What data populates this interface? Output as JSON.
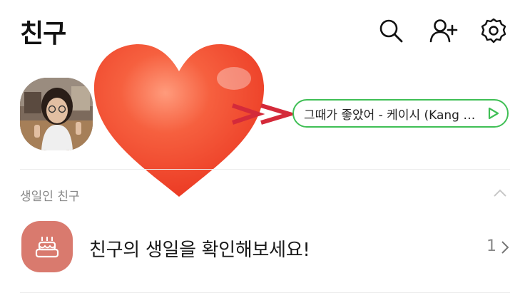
{
  "header": {
    "title": "친구",
    "icons": [
      "search-icon",
      "add-friend-icon",
      "settings-icon"
    ]
  },
  "profile": {
    "status_music": "그때가 좋았어 - 케이시 (Kang Kang...",
    "status_music_icon": "play-icon"
  },
  "overlay": {
    "heart_color": "#f04a2e",
    "arrow_color": "#d42a3a"
  },
  "section": {
    "title": "생일인 친구",
    "toggle_icon": "chevron-up-icon"
  },
  "birthday": {
    "label": "친구의 생일을 확인해보세요!",
    "count": "1",
    "icon": "cake-icon",
    "icon_bg": "#d97a6e"
  },
  "colors": {
    "accent_green": "#3fbf55",
    "section_text": "#888888"
  }
}
